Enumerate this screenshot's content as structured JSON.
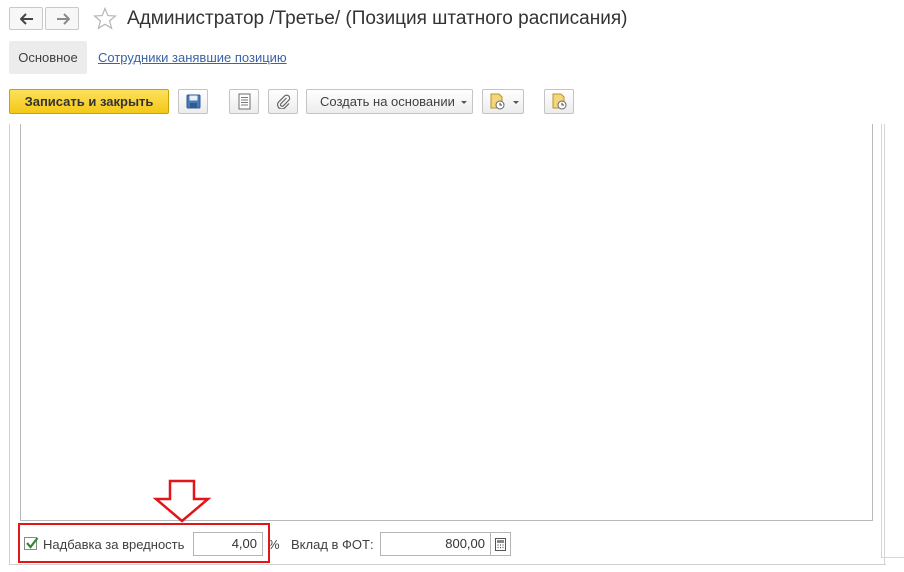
{
  "window": {
    "title": "Администратор /Третье/ (Позиция штатного расписания)",
    "icons": [
      "back-arrow-icon",
      "forward-arrow-icon",
      "favorite-star-icon"
    ]
  },
  "tabs": [
    {
      "label": "Основное",
      "active": true
    },
    {
      "label": "Сотрудники занявшие позицию",
      "active": false
    }
  ],
  "toolbar": {
    "save_close_label": "Записать и закрыть",
    "create_based_label": "Создать на основании",
    "icons": [
      "save-disk-icon",
      "document-list-icon",
      "paperclip-icon",
      "report-dropdown-icon",
      "report-history-icon"
    ]
  },
  "form": {
    "hazard_label": "Надбавка за вредность",
    "hazard_checked": true,
    "hazard_value": "4,00",
    "percent_sign": "%",
    "fot_label": "Вклад в ФОТ:",
    "fot_value": "800,00"
  },
  "colors": {
    "primary_button": "#f4c817",
    "link": "#3a63a8",
    "annotation": "#e0161b",
    "checkmark": "#2f8a2f"
  }
}
